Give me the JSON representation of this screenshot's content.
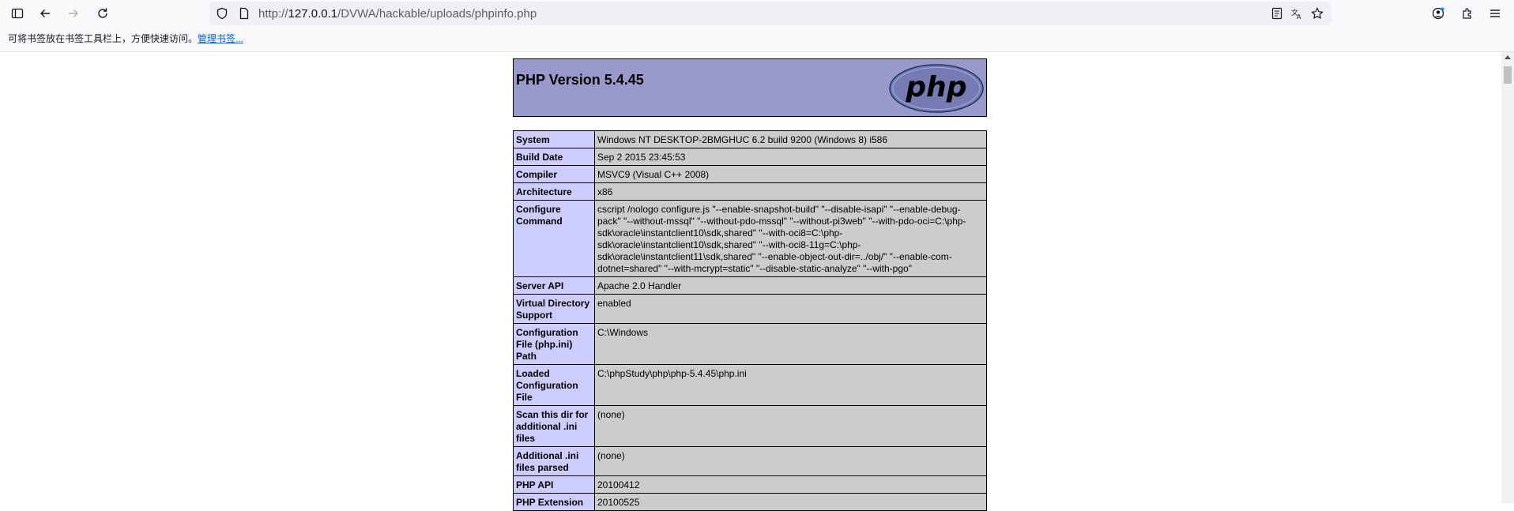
{
  "browser": {
    "url_prefix": "http://",
    "url_host": "127.0.0.1",
    "url_path": "/DVWA/hackable/uploads/phpinfo.php",
    "bookmarks_hint": "可将书签放在书签工具栏上，方便快速访问。",
    "bookmarks_manage": "管理书签...",
    "icons": [
      "sidebar-icon",
      "back-icon",
      "forward-icon",
      "reload-icon",
      "shield-icon",
      "page-icon",
      "reader-view-icon",
      "translate-icon",
      "bookmark-star-icon",
      "account-icon",
      "extensions-icon",
      "menu-icon"
    ]
  },
  "phpinfo": {
    "title": "PHP Version 5.4.45",
    "logo_text": "php",
    "rows": [
      {
        "key": "System",
        "value": "Windows NT DESKTOP-2BMGHUC 6.2 build 9200 (Windows 8) i586"
      },
      {
        "key": "Build Date",
        "value": "Sep 2 2015 23:45:53"
      },
      {
        "key": "Compiler",
        "value": "MSVC9 (Visual C++ 2008)"
      },
      {
        "key": "Architecture",
        "value": "x86"
      },
      {
        "key": "Configure Command",
        "value": "cscript /nologo configure.js \"--enable-snapshot-build\" \"--disable-isapi\" \"--enable-debug-pack\" \"--without-mssql\" \"--without-pdo-mssql\" \"--without-pi3web\" \"--with-pdo-oci=C:\\php-sdk\\oracle\\instantclient10\\sdk,shared\" \"--with-oci8=C:\\php-sdk\\oracle\\instantclient10\\sdk,shared\" \"--with-oci8-11g=C:\\php-sdk\\oracle\\instantclient11\\sdk,shared\" \"--enable-object-out-dir=../obj/\" \"--enable-com-dotnet=shared\" \"--with-mcrypt=static\" \"--disable-static-analyze\" \"--with-pgo\""
      },
      {
        "key": "Server API",
        "value": "Apache 2.0 Handler"
      },
      {
        "key": "Virtual Directory Support",
        "value": "enabled"
      },
      {
        "key": "Configuration File (php.ini) Path",
        "value": "C:\\Windows"
      },
      {
        "key": "Loaded Configuration File",
        "value": "C:\\phpStudy\\php\\php-5.4.45\\php.ini"
      },
      {
        "key": "Scan this dir for additional .ini files",
        "value": "(none)"
      },
      {
        "key": "Additional .ini files parsed",
        "value": "(none)"
      },
      {
        "key": "PHP API",
        "value": "20100412"
      },
      {
        "key": "PHP Extension",
        "value": "20100525"
      }
    ]
  }
}
